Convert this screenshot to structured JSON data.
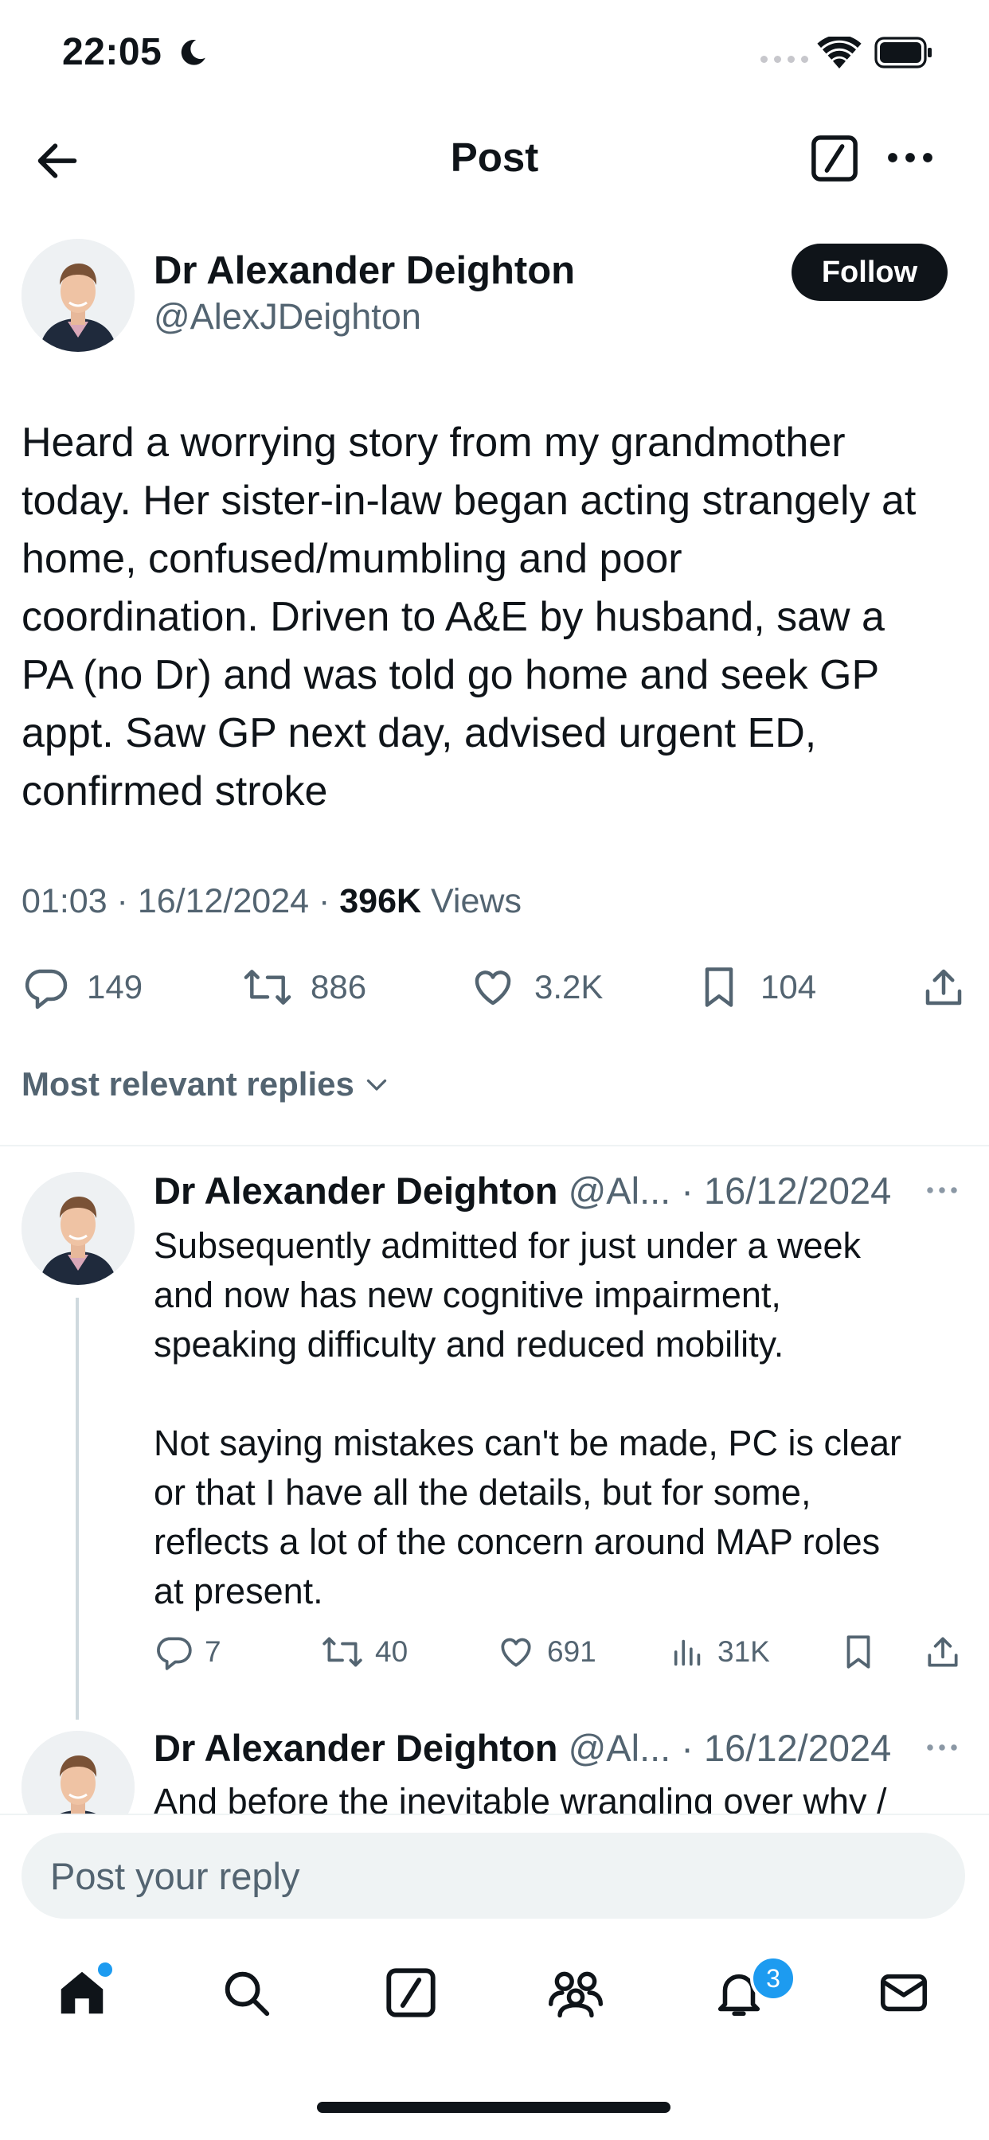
{
  "status_bar": {
    "time": "22:05"
  },
  "header": {
    "title": "Post"
  },
  "post": {
    "author_name": "Dr Alexander Deighton",
    "author_handle": "@AlexJDeighton",
    "follow_label": "Follow",
    "text": "Heard a worrying story from my grandmother\ntoday. Her sister-in-law began acting strangely at\nhome, confused/mumbling and poor\ncoordination. Driven to A&E by husband, saw a\nPA (no Dr) and was told go home and seek GP\nappt. Saw GP next day, advised urgent ED,\nconfirmed stroke",
    "time": "01:03",
    "date": "16/12/2024",
    "views_count": "396K",
    "views_label": "Views",
    "replies": "149",
    "reposts": "886",
    "likes": "3.2K",
    "bookmarks": "104"
  },
  "replies_sort": "Most relevant replies",
  "replies": [
    {
      "author_name": "Dr Alexander Deighton",
      "handle": "@Al...",
      "date": "16/12/2024",
      "text": "Subsequently admitted for just under a week\nand now has new cognitive impairment,\nspeaking difficulty and reduced mobility.\n\nNot saying mistakes can't be made, PC is clear\nor that I have all the details, but for some,\nreflects a lot of the concern around MAP roles\nat present.",
      "replies": "7",
      "reposts": "40",
      "likes": "691",
      "views": "31K"
    },
    {
      "author_name": "Dr Alexander Deighton",
      "handle": "@Al...",
      "date": "16/12/2024",
      "text": "And before the inevitable wrangling over why /"
    }
  ],
  "reply_bar": {
    "placeholder": "Post your reply"
  },
  "tab_bar": {
    "notifications_badge": "3"
  },
  "colors": {
    "text": "#0f1419",
    "secondary": "#536471",
    "accent": "#1d9bf0",
    "divider": "#eff3f4"
  },
  "icons": [
    "back-arrow-icon",
    "compose-icon",
    "more-icon",
    "reply-icon",
    "repost-icon",
    "like-icon",
    "bookmark-icon",
    "share-icon",
    "views-icon",
    "home-icon",
    "search-icon",
    "grok-icon",
    "communities-icon",
    "bell-icon",
    "mail-icon"
  ]
}
